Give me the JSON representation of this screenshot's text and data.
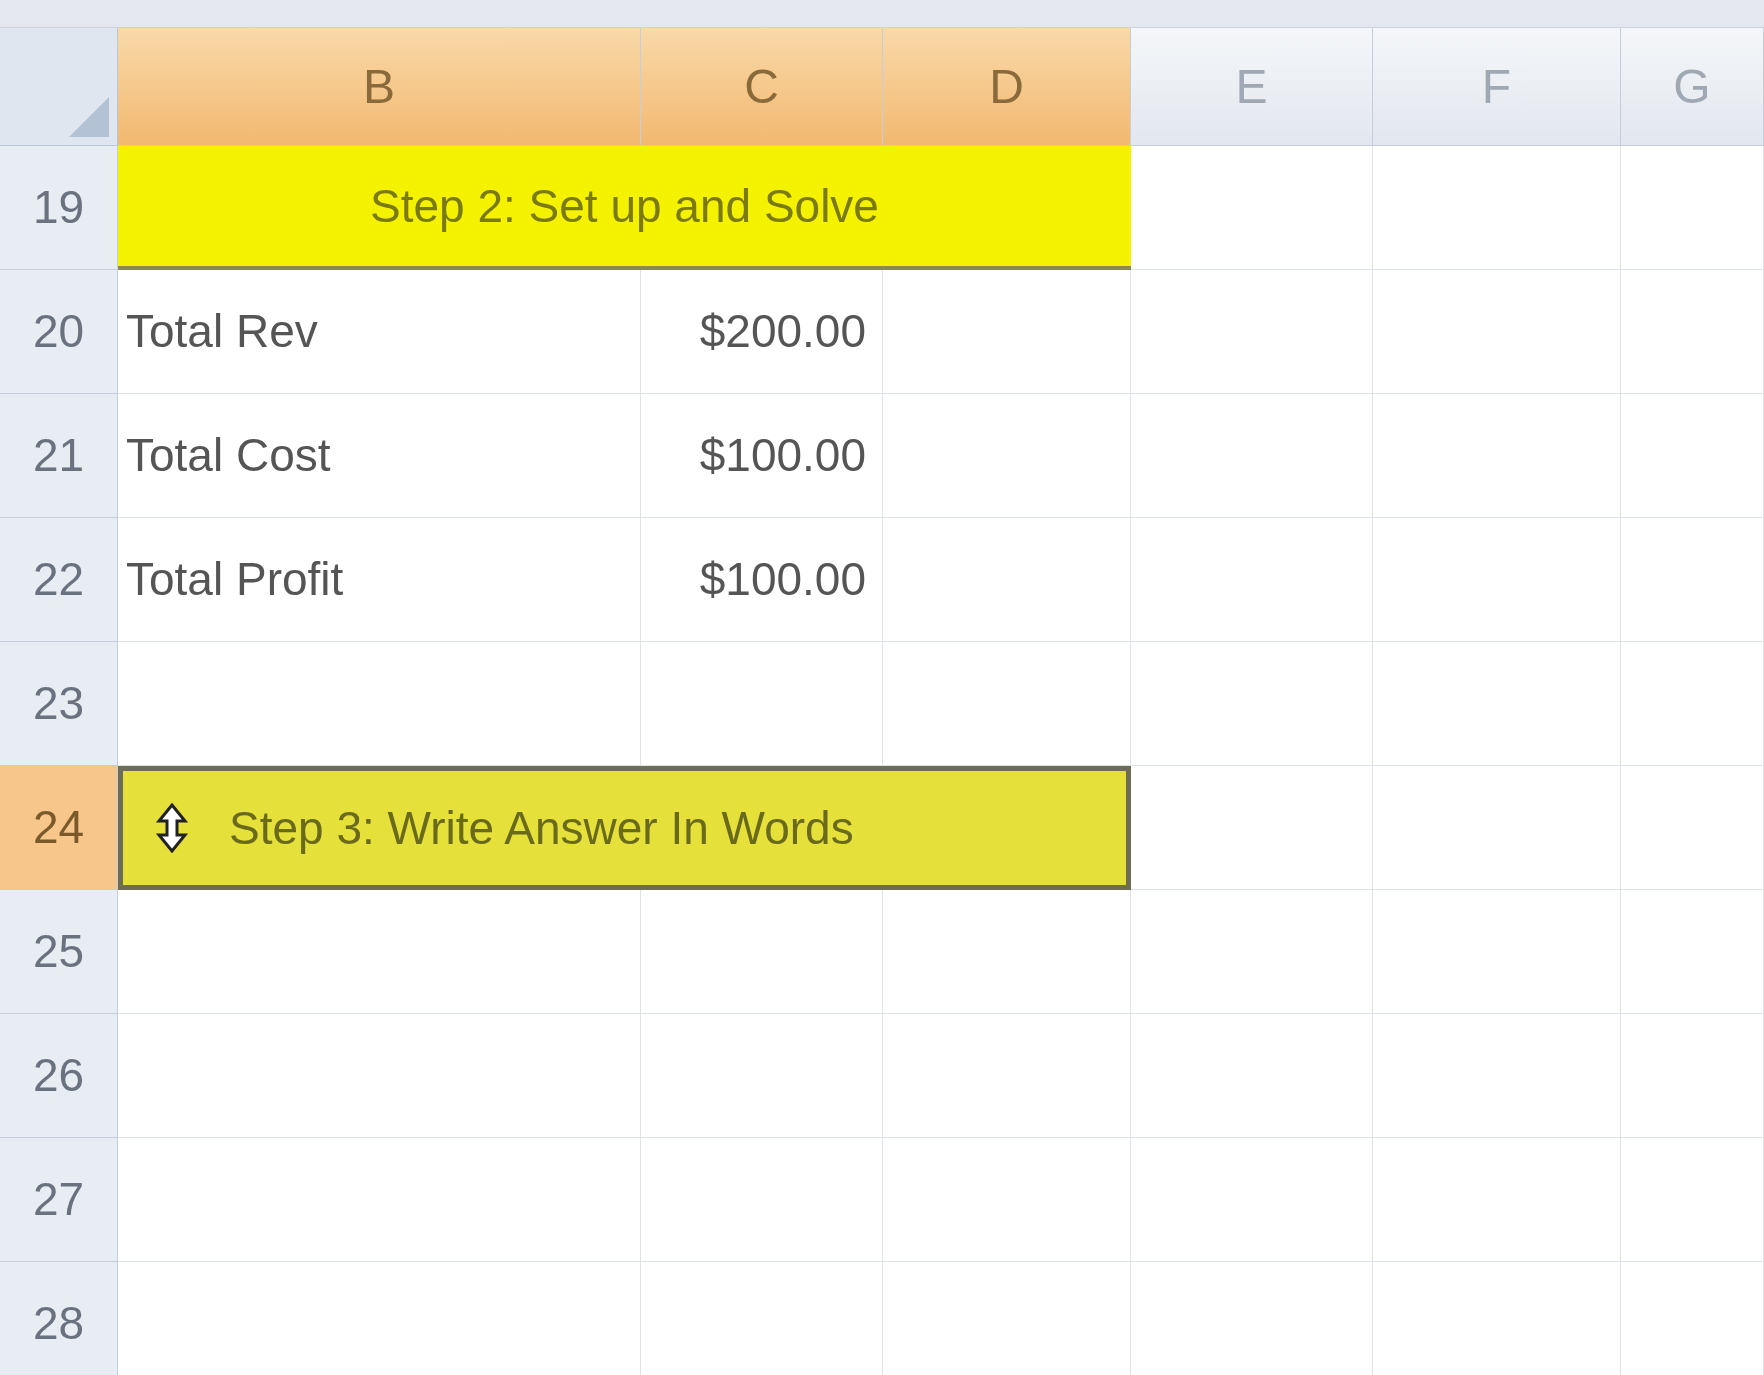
{
  "columns": [
    {
      "label": "B",
      "selected": true
    },
    {
      "label": "C",
      "selected": true
    },
    {
      "label": "D",
      "selected": true
    },
    {
      "label": "E",
      "selected": false
    },
    {
      "label": "F",
      "selected": false
    },
    {
      "label": "G",
      "selected": false
    }
  ],
  "rows": [
    {
      "number": "19",
      "selected": false,
      "kind": "banner",
      "text": "Step 2: Set up and Solve"
    },
    {
      "number": "20",
      "selected": false,
      "kind": "data",
      "label": "Total Rev",
      "value": "$200.00"
    },
    {
      "number": "21",
      "selected": false,
      "kind": "data",
      "label": "Total Cost",
      "value": "$100.00"
    },
    {
      "number": "22",
      "selected": false,
      "kind": "data",
      "label": "Total Profit",
      "value": "$100.00"
    },
    {
      "number": "23",
      "selected": false,
      "kind": "empty"
    },
    {
      "number": "24",
      "selected": true,
      "kind": "banner",
      "text": "Step 3: Write Answer In Words"
    },
    {
      "number": "25",
      "selected": false,
      "kind": "empty"
    },
    {
      "number": "26",
      "selected": false,
      "kind": "empty"
    },
    {
      "number": "27",
      "selected": false,
      "kind": "empty"
    },
    {
      "number": "28",
      "selected": false,
      "kind": "empty"
    }
  ]
}
